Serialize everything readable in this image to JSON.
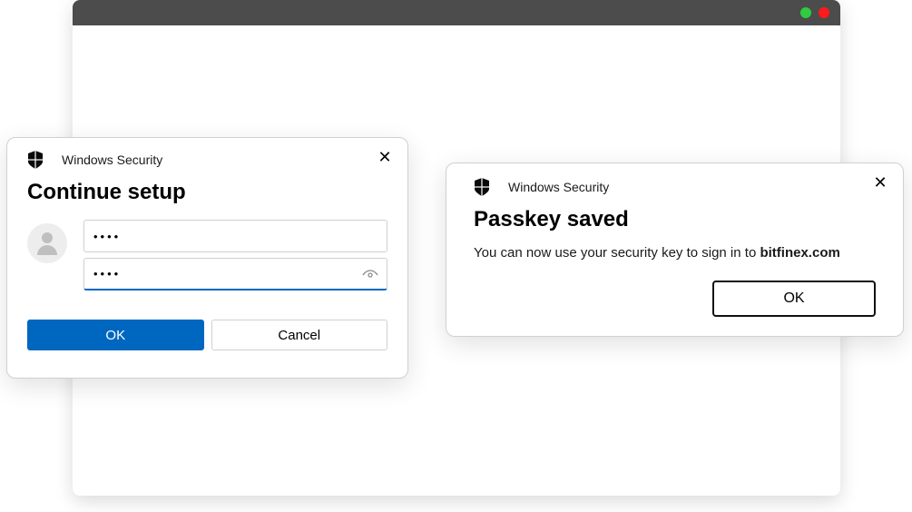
{
  "dialog_left": {
    "header_title": "Windows Security",
    "heading": "Continue setup",
    "username_value": "••••",
    "password_value": "••••",
    "ok_label": "OK",
    "cancel_label": "Cancel"
  },
  "dialog_right": {
    "header_title": "Windows Security",
    "heading": "Passkey saved",
    "message_prefix": "You can now use your security key to sign in to ",
    "domain": "bitfinex.com",
    "ok_label": "OK"
  }
}
